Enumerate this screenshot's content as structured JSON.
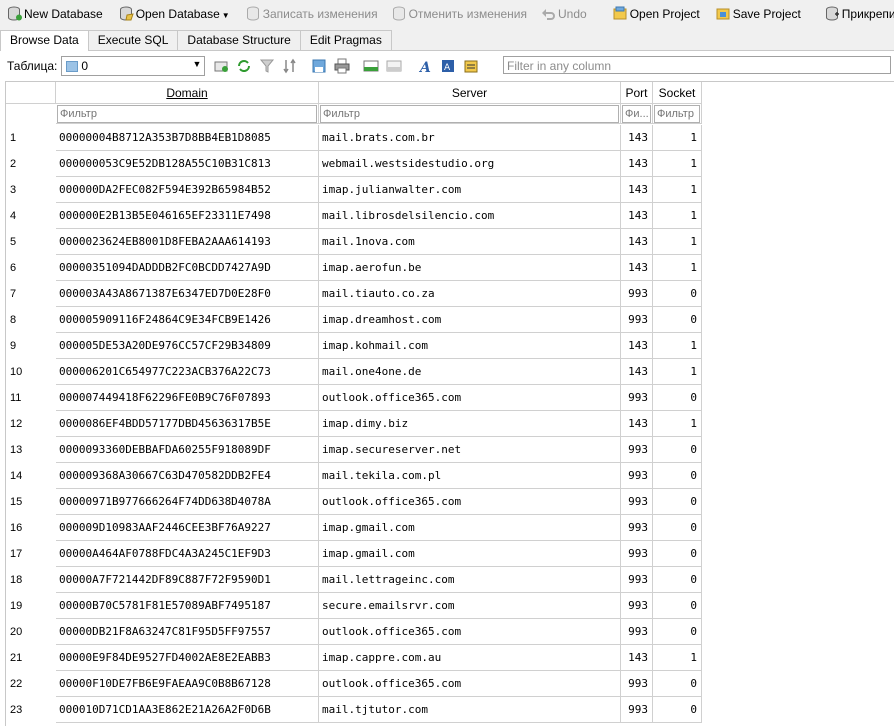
{
  "toolbar": {
    "new_database": "New Database",
    "open_database": "Open Database",
    "write_changes": "Записать изменения",
    "revert_changes": "Отменить изменения",
    "undo": "Undo",
    "open_project": "Open Project",
    "save_project": "Save Project",
    "attach_db": "Прикрепить БД"
  },
  "tabs": [
    "Browse Data",
    "Execute SQL",
    "Database Structure",
    "Edit Pragmas"
  ],
  "tablebar": {
    "label": "Таблица:",
    "selected_table": "0",
    "filter_placeholder": "Filter in any column"
  },
  "grid": {
    "columns": [
      "Domain",
      "Server",
      "Port",
      "Socket"
    ],
    "filters": [
      "Фильтр",
      "Фильтр",
      "Фи...",
      "Фильтр"
    ],
    "rows": [
      {
        "n": "1",
        "domain": "00000004B8712A353B7D8BB4EB1D8085",
        "server": "mail.brats.com.br",
        "port": "143",
        "socket": "1"
      },
      {
        "n": "2",
        "domain": "000000053C9E52DB128A55C10B31C813",
        "server": "webmail.westsidestudio.org",
        "port": "143",
        "socket": "1"
      },
      {
        "n": "3",
        "domain": "000000DA2FEC082F594E392B65984B52",
        "server": "imap.julianwalter.com",
        "port": "143",
        "socket": "1"
      },
      {
        "n": "4",
        "domain": "000000E2B13B5E046165EF23311E7498",
        "server": "mail.librosdelsilencio.com",
        "port": "143",
        "socket": "1"
      },
      {
        "n": "5",
        "domain": "0000023624EB8001D8FEBA2AAA614193",
        "server": "mail.1nova.com",
        "port": "143",
        "socket": "1"
      },
      {
        "n": "6",
        "domain": "00000351094DADDDB2FC0BCDD7427A9D",
        "server": "imap.aerofun.be",
        "port": "143",
        "socket": "1"
      },
      {
        "n": "7",
        "domain": "000003A43A8671387E6347ED7D0E28F0",
        "server": "mail.tiauto.co.za",
        "port": "993",
        "socket": "0"
      },
      {
        "n": "8",
        "domain": "000005909116F24864C9E34FCB9E1426",
        "server": "imap.dreamhost.com",
        "port": "993",
        "socket": "0"
      },
      {
        "n": "9",
        "domain": "000005DE53A20DE976CC57CF29B34809",
        "server": "imap.kohmail.com",
        "port": "143",
        "socket": "1"
      },
      {
        "n": "10",
        "domain": "000006201C654977C223ACB376A22C73",
        "server": "mail.one4one.de",
        "port": "143",
        "socket": "1"
      },
      {
        "n": "11",
        "domain": "000007449418F62296FE0B9C76F07893",
        "server": "outlook.office365.com",
        "port": "993",
        "socket": "0"
      },
      {
        "n": "12",
        "domain": "0000086EF4BDD57177DBD45636317B5E",
        "server": "imap.dimy.biz",
        "port": "143",
        "socket": "1"
      },
      {
        "n": "13",
        "domain": "0000093360DEBBAFDA60255F918089DF",
        "server": "imap.secureserver.net",
        "port": "993",
        "socket": "0"
      },
      {
        "n": "14",
        "domain": "000009368A30667C63D470582DDB2FE4",
        "server": "mail.tekila.com.pl",
        "port": "993",
        "socket": "0"
      },
      {
        "n": "15",
        "domain": "00000971B977666264F74DD638D4078A",
        "server": "outlook.office365.com",
        "port": "993",
        "socket": "0"
      },
      {
        "n": "16",
        "domain": "000009D10983AAF2446CEE3BF76A9227",
        "server": "imap.gmail.com",
        "port": "993",
        "socket": "0"
      },
      {
        "n": "17",
        "domain": "00000A464AF0788FDC4A3A245C1EF9D3",
        "server": "imap.gmail.com",
        "port": "993",
        "socket": "0"
      },
      {
        "n": "18",
        "domain": "00000A7F721442DF89C887F72F9590D1",
        "server": "mail.lettrageinc.com",
        "port": "993",
        "socket": "0"
      },
      {
        "n": "19",
        "domain": "00000B70C5781F81E57089ABF7495187",
        "server": "secure.emailsrvr.com",
        "port": "993",
        "socket": "0"
      },
      {
        "n": "20",
        "domain": "00000DB21F8A63247C81F95D5FF97557",
        "server": "outlook.office365.com",
        "port": "993",
        "socket": "0"
      },
      {
        "n": "21",
        "domain": "00000E9F84DE9527FD4002AE8E2EABB3",
        "server": "imap.cappre.com.au",
        "port": "143",
        "socket": "1"
      },
      {
        "n": "22",
        "domain": "00000F10DE7FB6E9FAEAA9C0B8B67128",
        "server": "outlook.office365.com",
        "port": "993",
        "socket": "0"
      },
      {
        "n": "23",
        "domain": "000010D71CD1AA3E862E21A26A2F0D6B",
        "server": "mail.tjtutor.com",
        "port": "993",
        "socket": "0"
      }
    ]
  }
}
